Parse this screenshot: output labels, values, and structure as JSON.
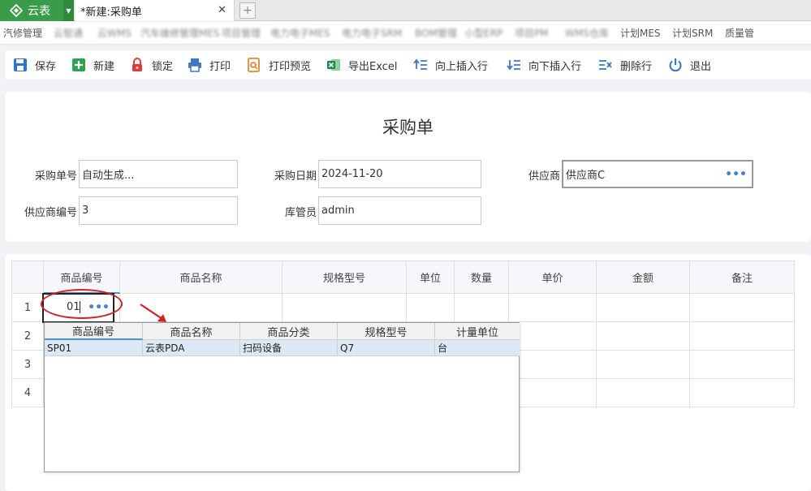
{
  "app": {
    "name": "云表"
  },
  "tabs": [
    {
      "label": "*新建:采购单"
    }
  ],
  "nav": {
    "items": [
      {
        "label": "汽修管理",
        "blurred": true
      },
      {
        "label": "云智通",
        "blurred": true
      },
      {
        "label": "云WMS",
        "blurred": true
      },
      {
        "label": "汽车维修管理MES",
        "blurred": true
      },
      {
        "label": "项目管理",
        "blurred": true
      },
      {
        "label": "电力电子MES",
        "blurred": true
      },
      {
        "label": "电力电子SRM",
        "blurred": true
      },
      {
        "label": "BOM管理",
        "blurred": true
      },
      {
        "label": "小型ERP",
        "blurred": true
      },
      {
        "label": "项目PM",
        "blurred": true
      },
      {
        "label": "WMS仓库",
        "blurred": true
      },
      {
        "label": "计划MES",
        "blurred": false
      },
      {
        "label": "计划SRM",
        "blurred": false
      },
      {
        "label": "质量管",
        "blurred": false
      }
    ]
  },
  "toolbar": {
    "save": "保存",
    "new": "新建",
    "lock": "锁定",
    "print": "打印",
    "preview": "打印预览",
    "export": "导出Excel",
    "insert_up": "向上插入行",
    "insert_down": "向下插入行",
    "delete_row": "删除行",
    "exit": "退出"
  },
  "form": {
    "title": "采购单",
    "order_no": {
      "label": "采购单号",
      "value": "自动生成..."
    },
    "order_date": {
      "label": "采购日期",
      "value": "2024-11-20"
    },
    "supplier": {
      "label": "供应商",
      "value": "供应商C"
    },
    "supplier_code": {
      "label": "供应商编号",
      "value": "3"
    },
    "keeper": {
      "label": "库管员",
      "value": "admin"
    }
  },
  "grid": {
    "columns": [
      "商品编号",
      "商品名称",
      "规格型号",
      "单位",
      "数量",
      "单价",
      "金额",
      "备注"
    ],
    "rows": [
      "1",
      "2",
      "3",
      "4"
    ],
    "editing_value": "01"
  },
  "popup": {
    "columns": [
      "商品编号",
      "商品名称",
      "商品分类",
      "规格型号",
      "计量单位"
    ],
    "rows": [
      [
        "SP01",
        "云表PDA",
        "扫码设备",
        "Q7",
        "台"
      ]
    ]
  },
  "colors": {
    "accent": "#3a9b48",
    "highlight": "#d82020",
    "selection": "#dbe9f6",
    "dots": "#4a7fe0"
  }
}
